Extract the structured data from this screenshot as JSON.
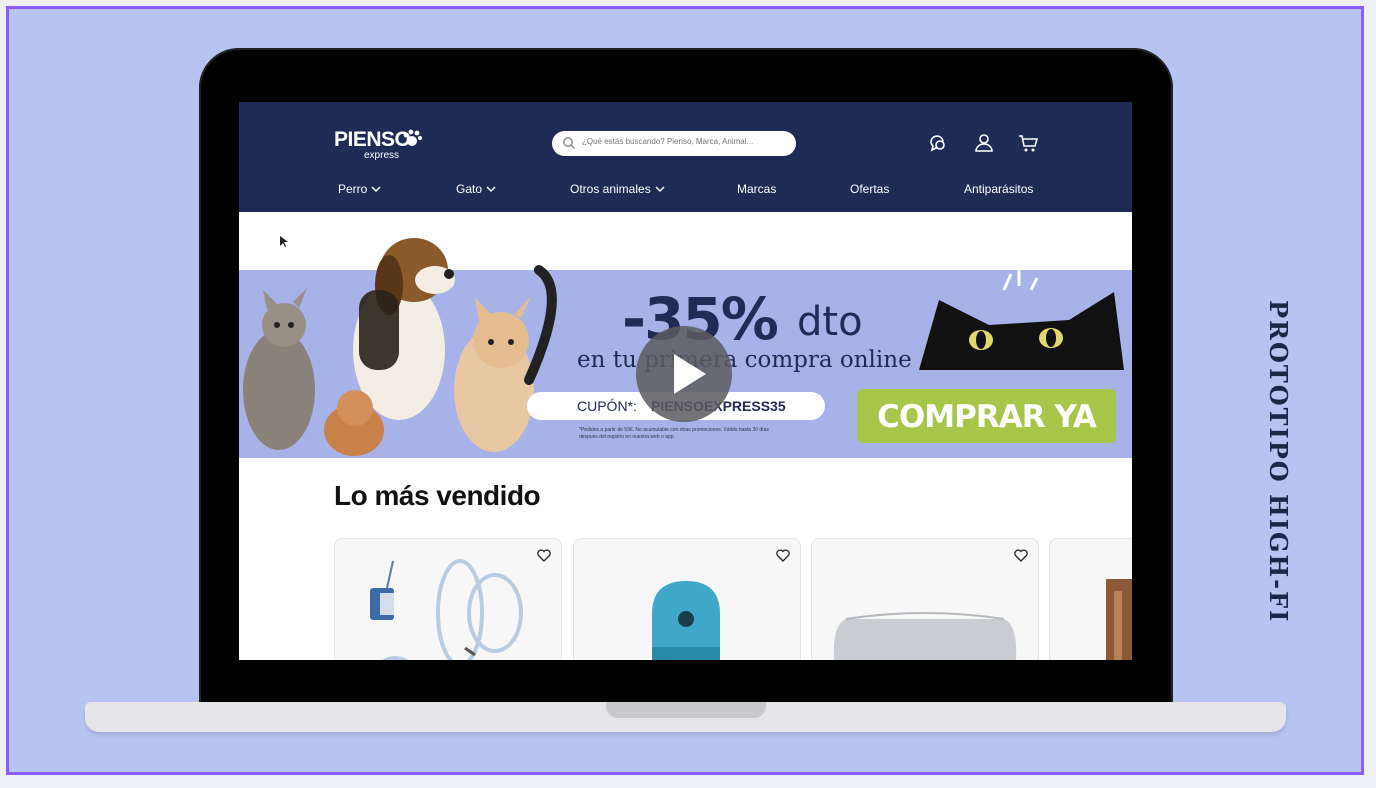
{
  "side_title": "PROTOTIPO HIGH-FI",
  "header": {
    "logo": {
      "main": "PIENSO",
      "sub": "express"
    },
    "search": {
      "placeholder": "¿Qué estás buscando? Pienso, Marca, Animal..."
    },
    "icons": [
      "chat-icon",
      "user-icon",
      "cart-icon"
    ]
  },
  "nav": [
    {
      "label": "Perro",
      "dropdown": true
    },
    {
      "label": "Gato",
      "dropdown": true
    },
    {
      "label": "Otros animales",
      "dropdown": true
    },
    {
      "label": "Marcas",
      "dropdown": false
    },
    {
      "label": "Ofertas",
      "dropdown": false
    },
    {
      "label": "Antiparásitos",
      "dropdown": false
    }
  ],
  "banner": {
    "headline": "-35%",
    "headline_suffix": "dto",
    "subline": "en tu primera compra online",
    "coupon_label": "CUPÓN*:",
    "coupon_code": "PIENSOEXPRESS35",
    "fineprint": "*Pedidos a partir de 59€. No acumulable con otras promociones. Válido hasta 30 días después del registro en nuestra web o app.",
    "cta": "COMPRAR YA"
  },
  "section": {
    "title": "Lo más vendido"
  },
  "colors": {
    "navy": "#1d2b55",
    "banner": "#a7b3e8",
    "cta": "#a6c64a",
    "background": "#b7c4f2",
    "border_accent": "#8b5cf6"
  }
}
